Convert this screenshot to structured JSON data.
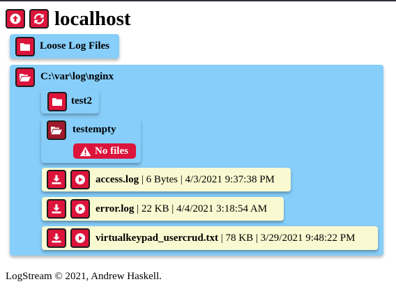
{
  "header": {
    "title": "localhost",
    "up_icon": "arrow-up-circle-icon",
    "refresh_icon": "refresh-icon"
  },
  "loose_folder": {
    "label": "Loose Log Files",
    "icon": "folder-icon"
  },
  "directory": {
    "path": "C:\\var\\log\\nginx",
    "icon": "folder-open-icon",
    "subfolders": [
      {
        "label": "test2",
        "icon": "folder-icon"
      },
      {
        "label": "testempty",
        "icon": "folder-open-icon",
        "badge": "No files",
        "badge_icon": "warning-icon"
      }
    ],
    "files": [
      {
        "name": "access.log",
        "size": "6 Bytes",
        "date": "4/3/2021 9:37:38 PM"
      },
      {
        "name": "error.log",
        "size": "22 KB",
        "date": "4/4/2021 3:18:54 AM"
      },
      {
        "name": "virtualkeypad_usercrud.txt",
        "size": "78 KB",
        "date": "3/29/2021 9:48:22 PM"
      }
    ],
    "separator": " | "
  },
  "footer": {
    "text": "LogStream © 2021, Andrew Haskell."
  },
  "colors": {
    "button": "#dc143c",
    "button_active": "#a01a2c",
    "panel": "#87cefa",
    "file_row": "#fafad2"
  }
}
